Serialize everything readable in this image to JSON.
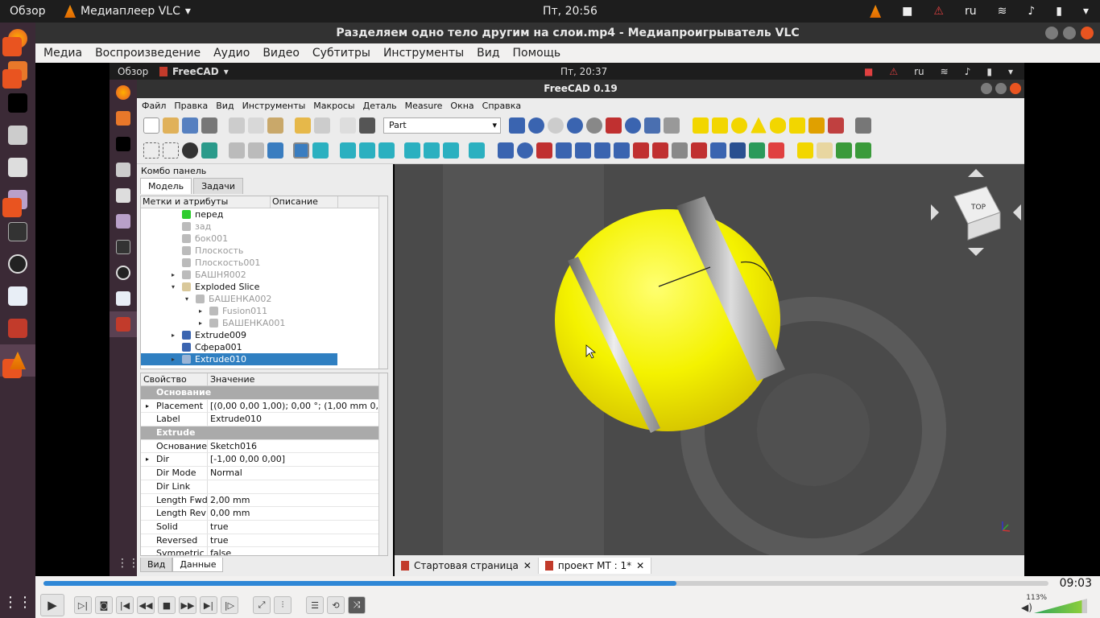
{
  "topbar": {
    "overview": "Обзор",
    "app_name": "Медиаплеер VLC",
    "clock": "Пт, 20:56",
    "lang": "ru"
  },
  "vlc": {
    "title": "Разделяем одно тело другим на слои.mp4 - Медиапроигрыватель VLC",
    "menu": [
      "Медиа",
      "Воспроизведение",
      "Аудио",
      "Видео",
      "Субтитры",
      "Инструменты",
      "Вид",
      "Помощь"
    ],
    "time": "09:03",
    "progress": 0.63,
    "volume_label": "113%",
    "volume": 1.13
  },
  "inner_topbar": {
    "overview": "Обзор",
    "app_name": "FreeCAD",
    "clock": "Пт, 20:37",
    "lang": "ru"
  },
  "freecad": {
    "title": "FreeCAD 0.19",
    "menu": [
      "Файл",
      "Правка",
      "Вид",
      "Инструменты",
      "Макросы",
      "Деталь",
      "Measure",
      "Окна",
      "Справка"
    ],
    "workbench": "Part",
    "combo_title": "Комбо панель",
    "tabs": [
      "Модель",
      "Задачи"
    ],
    "tree_headers": [
      "Метки и атрибуты",
      "Описание"
    ],
    "tree": [
      {
        "label": "перед",
        "indent": 2,
        "color": "#2ecc2e",
        "dim": false,
        "arrow": ""
      },
      {
        "label": "зад",
        "indent": 2,
        "color": "#bbbbbb",
        "dim": true,
        "arrow": ""
      },
      {
        "label": "бок001",
        "indent": 2,
        "color": "#bbbbbb",
        "dim": true,
        "arrow": ""
      },
      {
        "label": "Плоскость",
        "indent": 2,
        "color": "#bbbbbb",
        "dim": true,
        "arrow": ""
      },
      {
        "label": "Плоскость001",
        "indent": 2,
        "color": "#bbbbbb",
        "dim": true,
        "arrow": ""
      },
      {
        "label": "БАШНЯ002",
        "indent": 2,
        "color": "#bbbbbb",
        "dim": true,
        "arrow": "▸"
      },
      {
        "label": "Exploded Slice",
        "indent": 2,
        "color": "#d9c89a",
        "dim": false,
        "arrow": "▾"
      },
      {
        "label": "БАШЕНКА002",
        "indent": 3,
        "color": "#bbbbbb",
        "dim": true,
        "arrow": "▾"
      },
      {
        "label": "Fusion011",
        "indent": 4,
        "color": "#bbbbbb",
        "dim": true,
        "arrow": "▸"
      },
      {
        "label": "БАШЕНКА001",
        "indent": 4,
        "color": "#bbbbbb",
        "dim": true,
        "arrow": "▸"
      },
      {
        "label": "Extrude009",
        "indent": 2,
        "color": "#3a64b0",
        "dim": false,
        "arrow": "▸"
      },
      {
        "label": "Сфера001",
        "indent": 2,
        "color": "#3a64b0",
        "dim": false,
        "arrow": ""
      },
      {
        "label": "Extrude010",
        "indent": 2,
        "color": "#9bb5d6",
        "dim": false,
        "arrow": "▸",
        "selected": true
      }
    ],
    "prop_headers": [
      "Свойство",
      "Значение"
    ],
    "props": [
      {
        "group": true,
        "key": "Основание",
        "value": ""
      },
      {
        "key": "Placement",
        "value": "[(0,00 0,00 1,00); 0,00 °; (1,00 mm  0,...",
        "expand": true
      },
      {
        "key": "Label",
        "value": "Extrude010"
      },
      {
        "group": true,
        "key": "Extrude",
        "value": ""
      },
      {
        "key": "Основание",
        "value": "Sketch016"
      },
      {
        "key": "Dir",
        "value": "[-1,00 0,00 0,00]",
        "expand": true
      },
      {
        "key": "Dir Mode",
        "value": "Normal"
      },
      {
        "key": "Dir Link",
        "value": ""
      },
      {
        "key": "Length Fwd",
        "value": "2,00 mm"
      },
      {
        "key": "Length Rev",
        "value": "0,00 mm"
      },
      {
        "key": "Solid",
        "value": "true"
      },
      {
        "key": "Reversed",
        "value": "true"
      },
      {
        "key": "Symmetric",
        "value": "false"
      }
    ],
    "bottom_tabs": [
      "Вид",
      "Данные"
    ],
    "doc_tabs": [
      "Стартовая страница",
      "проект МТ : 1*"
    ],
    "navcube_label": "TOP"
  }
}
